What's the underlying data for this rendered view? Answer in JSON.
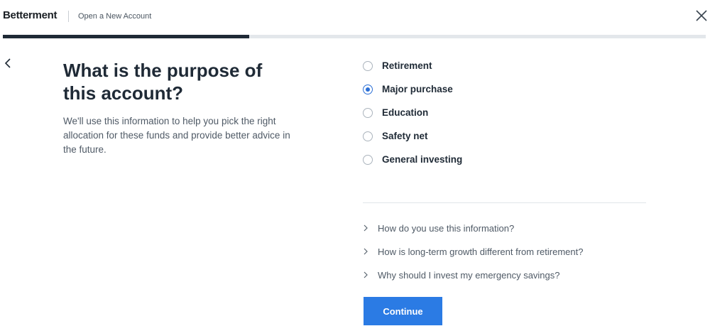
{
  "header": {
    "logo": "Betterment",
    "subtitle": "Open a New Account",
    "close_icon": "close-icon"
  },
  "progress": {
    "fraction": 0.35
  },
  "nav": {
    "back_icon": "chevron-left-icon"
  },
  "question": {
    "title": "What is the purpose of this account?",
    "description": "We'll use this information to help you pick the right allocation for these funds and provide better advice in the future."
  },
  "options": [
    {
      "label": "Retirement",
      "selected": false
    },
    {
      "label": "Major purchase",
      "selected": true
    },
    {
      "label": "Education",
      "selected": false
    },
    {
      "label": "Safety net",
      "selected": false
    },
    {
      "label": "General investing",
      "selected": false
    }
  ],
  "faq": [
    {
      "text": "How do you use this information?",
      "icon": "chevron-right-icon"
    },
    {
      "text": "How is long-term growth different from retirement?",
      "icon": "chevron-right-icon"
    },
    {
      "text": "Why should I invest my emergency savings?",
      "icon": "chevron-right-icon"
    }
  ],
  "actions": {
    "continue_label": "Continue"
  },
  "colors": {
    "accent": "#2b7be4",
    "text_dark": "#1f2a36",
    "progress_fill": "#1f2a36",
    "progress_track": "#e3e7eb"
  }
}
